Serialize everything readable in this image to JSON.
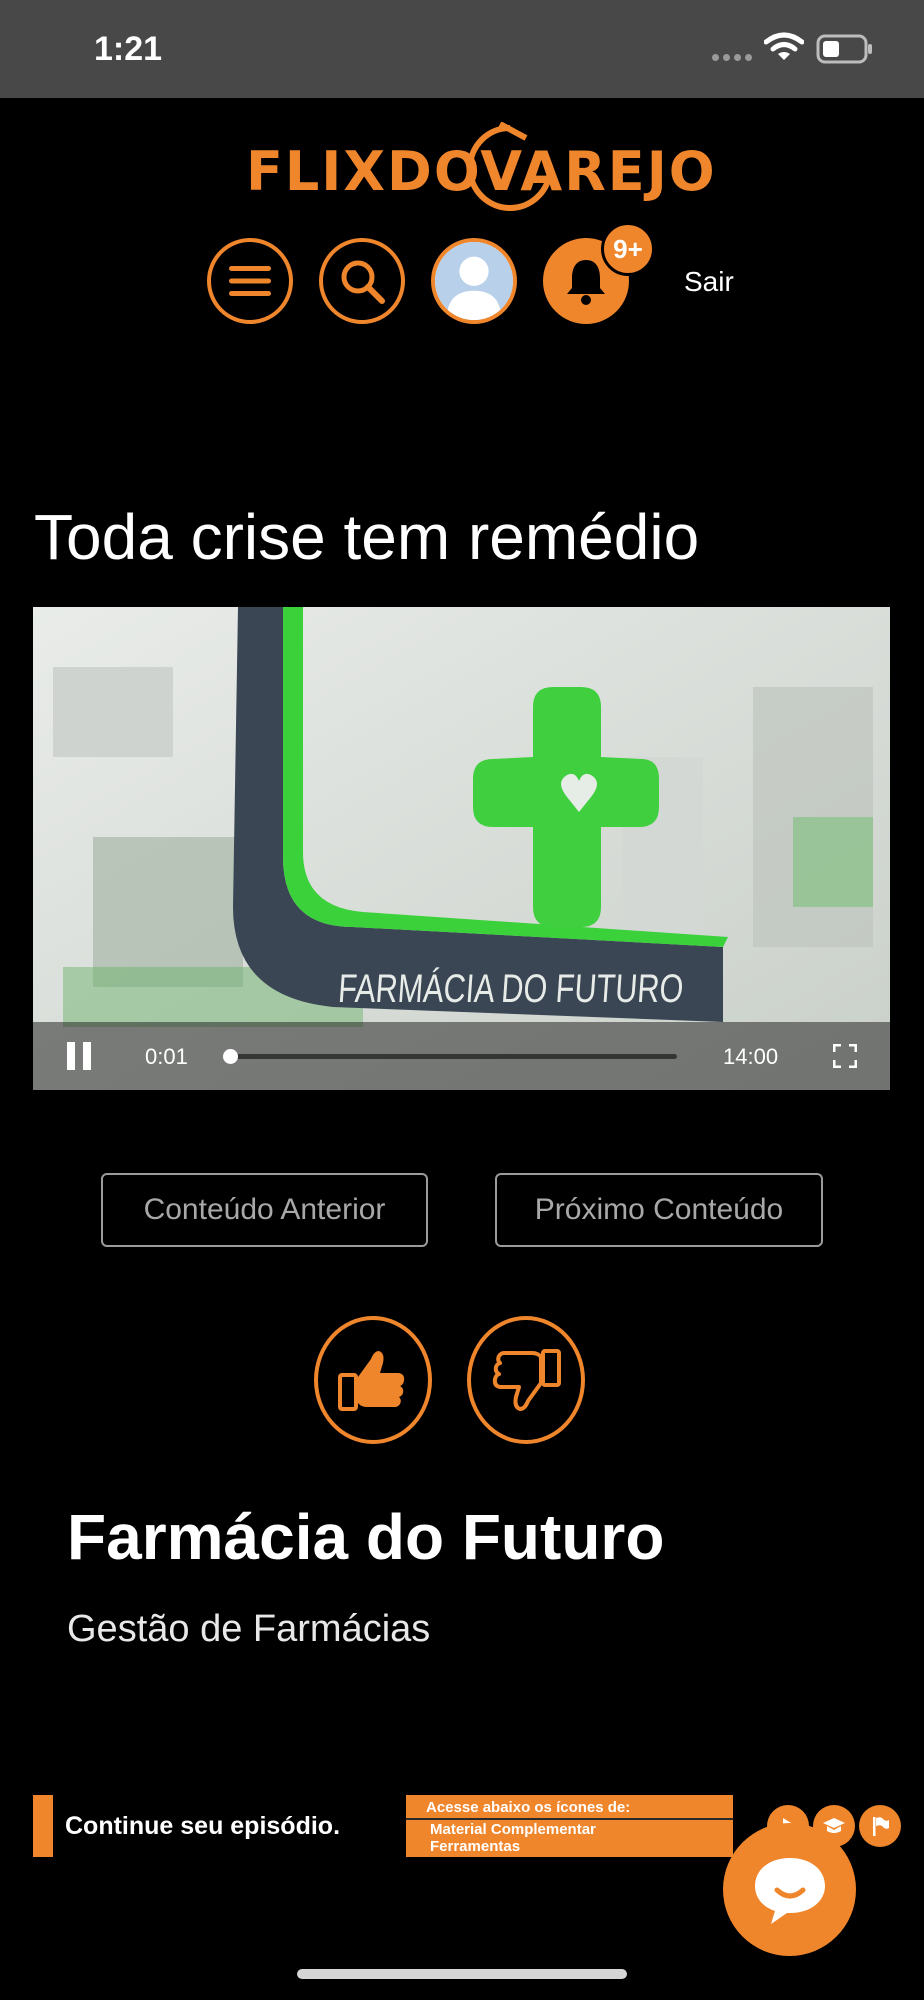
{
  "status_bar": {
    "time": "1:21"
  },
  "header": {
    "logo_text": "FLIXDOVAREJO",
    "notification_count": "9+",
    "logout_label": "Sair"
  },
  "content": {
    "title": "Toda crise tem remédio",
    "video": {
      "overlay_text": "FARMÁCIA DO FUTURO",
      "current_time": "0:01",
      "duration": "14:00",
      "progress": 0.0012,
      "state": "playing"
    },
    "prev_label": "Conteúdo Anterior",
    "next_label": "Próximo Conteúdo",
    "show_title": "Farmácia do Futuro",
    "show_category": "Gestão de Farmácias"
  },
  "banner": {
    "headline": "Continue seu episódio.",
    "line1": "Acesse abaixo os ícones de:",
    "line2": "Material Complementar",
    "line3": "Ferramentas"
  },
  "colors": {
    "accent": "#f0862c",
    "background": "#000000",
    "status_bar": "#484848"
  }
}
